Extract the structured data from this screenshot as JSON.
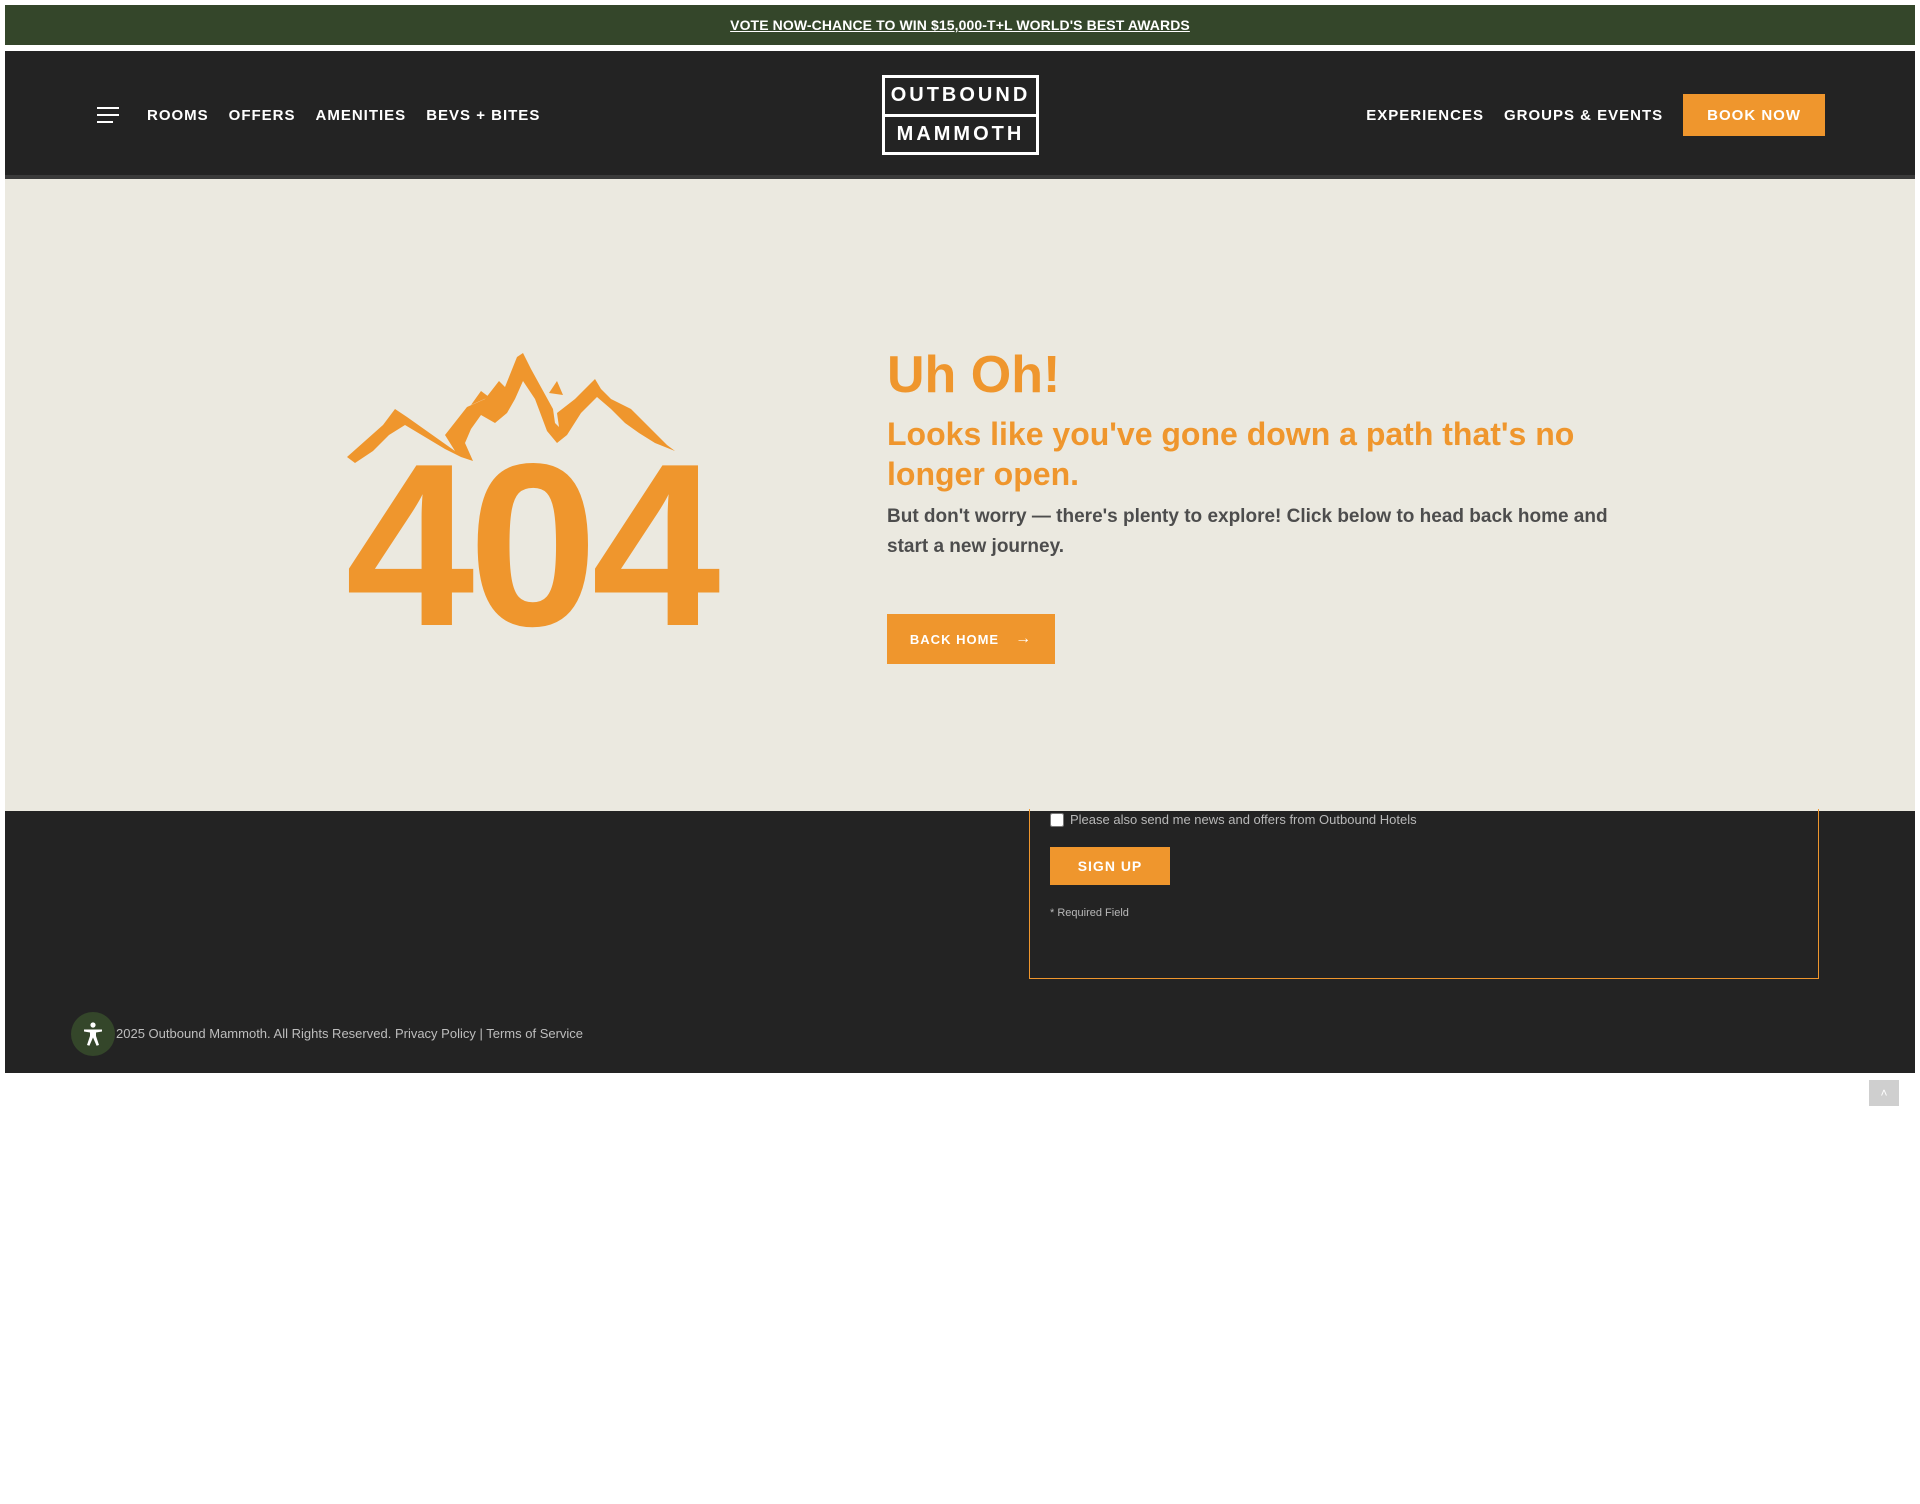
{
  "announcement": {
    "text": "VOTE NOW-CHANCE TO WIN $15,000-T+L WORLD'S BEST AWARDS"
  },
  "header": {
    "nav_left": [
      "ROOMS",
      "OFFERS",
      "AMENITIES",
      "BEVS + BITES"
    ],
    "logo": {
      "line1": "OUTBOUND",
      "line2": "MAMMOTH"
    },
    "nav_right": [
      "EXPERIENCES",
      "GROUPS & EVENTS"
    ],
    "book_label": "BOOK NOW"
  },
  "hero": {
    "art_text": "404",
    "title": "Uh Oh!",
    "subtitle": "Looks like you've gone down a path that's no longer open.",
    "body": "But don't worry — there's plenty to explore! Click below to head back home and start a new journey.",
    "button_label": "BACK HOME"
  },
  "footer": {
    "checkbox_label": "Please also send me news and offers from Outbound Hotels",
    "signup_label": "SIGN UP",
    "required_note": "* Required Field",
    "copyright": "2025 Outbound Mammoth. All Rights Reserved.",
    "privacy_label": "Privacy Policy",
    "separator": " | ",
    "terms_label": "Terms of Service"
  },
  "colors": {
    "accent": "#ef962d",
    "forest": "#34462a",
    "dark": "#232323",
    "sand": "#ebe9e0"
  },
  "icons": {
    "menu": "hamburger-icon",
    "arrow": "arrow-right-icon",
    "accessibility": "accessibility-icon",
    "scroll_top": "chevron-up-icon"
  }
}
